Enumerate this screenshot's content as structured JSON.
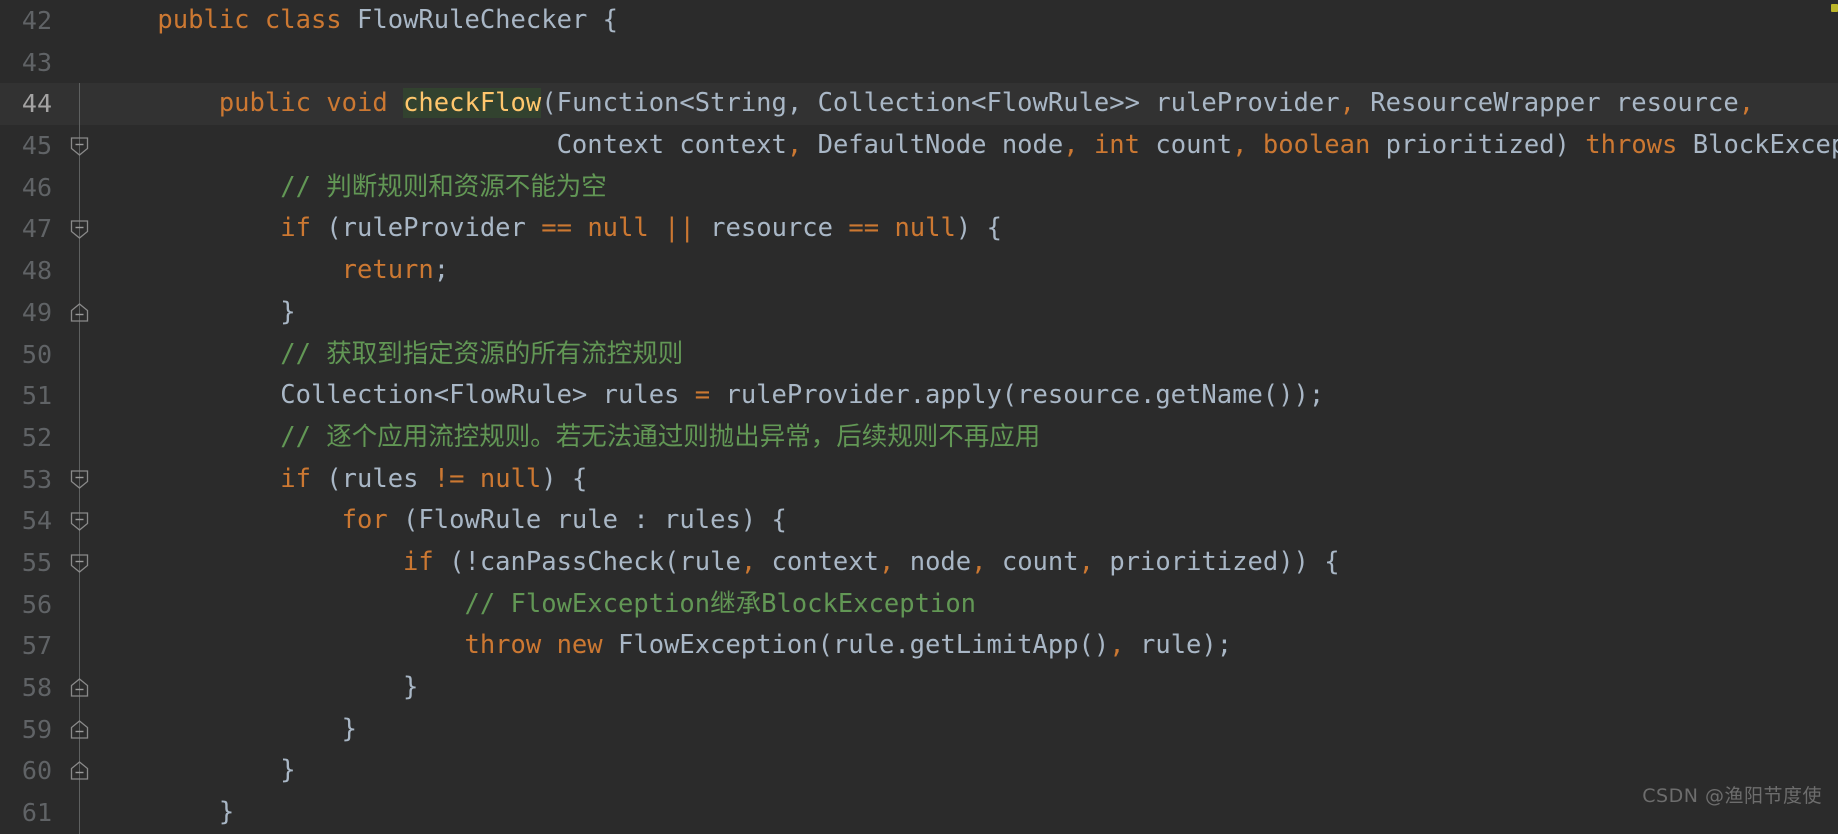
{
  "app": {
    "type": "code-editor",
    "theme": "darcula",
    "language": "java",
    "background": "#2b2b2b",
    "current_line_background": "#323232",
    "gutter_text_color": "#606366",
    "default_text_color": "#a9b7c6",
    "keyword_color": "#cc7832",
    "comment_color": "#629755",
    "method_color": "#ffc66d",
    "method_highlight_background": "#32422f",
    "number_color": "#6897bb"
  },
  "watermark": {
    "text": "CSDN @渔阳节度使"
  },
  "editor": {
    "first_line_number": 42,
    "current_line_number": 44,
    "lines": [
      {
        "number": "42",
        "fold": "none",
        "fold_line": false,
        "current": false,
        "tokens": [
          {
            "t": "    ",
            "c": "plain"
          },
          {
            "t": "public class ",
            "c": "kw"
          },
          {
            "t": "FlowRuleChecker ",
            "c": "plain"
          },
          {
            "t": "{",
            "c": "punc"
          }
        ],
        "plain": "public class FlowRuleChecker {"
      },
      {
        "number": "43",
        "fold": "none",
        "fold_line": false,
        "current": false,
        "tokens": [],
        "plain": ""
      },
      {
        "number": "44",
        "fold": "none",
        "fold_line": true,
        "current": true,
        "tokens": [
          {
            "t": "        ",
            "c": "plain"
          },
          {
            "t": "public void ",
            "c": "kw"
          },
          {
            "t": "checkFlow",
            "c": "method-hl"
          },
          {
            "t": "(Function<String, Collection<FlowRule>> ruleProvider",
            "c": "plain"
          },
          {
            "t": ",",
            "c": "kw"
          },
          {
            "t": " ResourceWrapper resource",
            "c": "plain"
          },
          {
            "t": ",",
            "c": "kw"
          }
        ],
        "plain": "public void checkFlow(Function<String, Collection<FlowRule>> ruleProvider, ResourceWrapper resource,"
      },
      {
        "number": "45",
        "fold": "start",
        "fold_line": true,
        "current": false,
        "tokens": [
          {
            "t": "                              ",
            "c": "plain"
          },
          {
            "t": "Context context",
            "c": "plain"
          },
          {
            "t": ",",
            "c": "kw"
          },
          {
            "t": " DefaultNode node",
            "c": "plain"
          },
          {
            "t": ",",
            "c": "kw"
          },
          {
            "t": " ",
            "c": "plain"
          },
          {
            "t": "int",
            "c": "kw"
          },
          {
            "t": " count",
            "c": "plain"
          },
          {
            "t": ",",
            "c": "kw"
          },
          {
            "t": " ",
            "c": "plain"
          },
          {
            "t": "boolean",
            "c": "kw"
          },
          {
            "t": " prioritized) ",
            "c": "plain"
          },
          {
            "t": "throws",
            "c": "kw"
          },
          {
            "t": " BlockException",
            "c": "plain"
          }
        ],
        "plain": "Context context, DefaultNode node, int count, boolean prioritized) throws BlockException"
      },
      {
        "number": "46",
        "fold": "none",
        "fold_line": true,
        "current": false,
        "tokens": [
          {
            "t": "            ",
            "c": "plain"
          },
          {
            "t": "// 判断规则和资源不能为空",
            "c": "comment"
          }
        ],
        "plain": "// 判断规则和资源不能为空"
      },
      {
        "number": "47",
        "fold": "start",
        "fold_line": true,
        "current": false,
        "tokens": [
          {
            "t": "            ",
            "c": "plain"
          },
          {
            "t": "if",
            "c": "kw"
          },
          {
            "t": " (ruleProvider ",
            "c": "plain"
          },
          {
            "t": "==",
            "c": "kw"
          },
          {
            "t": " ",
            "c": "plain"
          },
          {
            "t": "null",
            "c": "kw"
          },
          {
            "t": " ",
            "c": "plain"
          },
          {
            "t": "||",
            "c": "kw"
          },
          {
            "t": " resource ",
            "c": "plain"
          },
          {
            "t": "==",
            "c": "kw"
          },
          {
            "t": " ",
            "c": "plain"
          },
          {
            "t": "null",
            "c": "kw"
          },
          {
            "t": ") {",
            "c": "plain"
          }
        ],
        "plain": "if (ruleProvider == null || resource == null) {"
      },
      {
        "number": "48",
        "fold": "none",
        "fold_line": true,
        "current": false,
        "tokens": [
          {
            "t": "                ",
            "c": "plain"
          },
          {
            "t": "return",
            "c": "kw"
          },
          {
            "t": ";",
            "c": "plain"
          }
        ],
        "plain": "return;"
      },
      {
        "number": "49",
        "fold": "end",
        "fold_line": true,
        "current": false,
        "tokens": [
          {
            "t": "            ",
            "c": "plain"
          },
          {
            "t": "}",
            "c": "plain"
          }
        ],
        "plain": "}"
      },
      {
        "number": "50",
        "fold": "none",
        "fold_line": true,
        "current": false,
        "tokens": [
          {
            "t": "            ",
            "c": "plain"
          },
          {
            "t": "// 获取到指定资源的所有流控规则",
            "c": "comment"
          }
        ],
        "plain": "// 获取到指定资源的所有流控规则"
      },
      {
        "number": "51",
        "fold": "none",
        "fold_line": true,
        "current": false,
        "tokens": [
          {
            "t": "            ",
            "c": "plain"
          },
          {
            "t": "Collection<FlowRule> rules ",
            "c": "plain"
          },
          {
            "t": "=",
            "c": "kw"
          },
          {
            "t": " ruleProvider.apply(resource.getName());",
            "c": "plain"
          }
        ],
        "plain": "Collection<FlowRule> rules = ruleProvider.apply(resource.getName());"
      },
      {
        "number": "52",
        "fold": "none",
        "fold_line": true,
        "current": false,
        "tokens": [
          {
            "t": "            ",
            "c": "plain"
          },
          {
            "t": "// 逐个应用流控规则。若无法通过则抛出异常，后续规则不再应用",
            "c": "comment"
          }
        ],
        "plain": "// 逐个应用流控规则。若无法通过则抛出异常，后续规则不再应用"
      },
      {
        "number": "53",
        "fold": "start",
        "fold_line": true,
        "current": false,
        "tokens": [
          {
            "t": "            ",
            "c": "plain"
          },
          {
            "t": "if",
            "c": "kw"
          },
          {
            "t": " (rules ",
            "c": "plain"
          },
          {
            "t": "!=",
            "c": "kw"
          },
          {
            "t": " ",
            "c": "plain"
          },
          {
            "t": "null",
            "c": "kw"
          },
          {
            "t": ") {",
            "c": "plain"
          }
        ],
        "plain": "if (rules != null) {"
      },
      {
        "number": "54",
        "fold": "start",
        "fold_line": true,
        "current": false,
        "tokens": [
          {
            "t": "                ",
            "c": "plain"
          },
          {
            "t": "for",
            "c": "kw"
          },
          {
            "t": " (FlowRule rule : rules) {",
            "c": "plain"
          }
        ],
        "plain": "for (FlowRule rule : rules) {"
      },
      {
        "number": "55",
        "fold": "start",
        "fold_line": true,
        "current": false,
        "tokens": [
          {
            "t": "                    ",
            "c": "plain"
          },
          {
            "t": "if",
            "c": "kw"
          },
          {
            "t": " (!canPassCheck(rule",
            "c": "plain"
          },
          {
            "t": ",",
            "c": "kw"
          },
          {
            "t": " context",
            "c": "plain"
          },
          {
            "t": ",",
            "c": "kw"
          },
          {
            "t": " node",
            "c": "plain"
          },
          {
            "t": ",",
            "c": "kw"
          },
          {
            "t": " count",
            "c": "plain"
          },
          {
            "t": ",",
            "c": "kw"
          },
          {
            "t": " prioritized)) {",
            "c": "plain"
          }
        ],
        "plain": "if (!canPassCheck(rule, context, node, count, prioritized)) {"
      },
      {
        "number": "56",
        "fold": "none",
        "fold_line": true,
        "current": false,
        "tokens": [
          {
            "t": "                        ",
            "c": "plain"
          },
          {
            "t": "// FlowException继承BlockException",
            "c": "comment"
          }
        ],
        "plain": "// FlowException继承BlockException"
      },
      {
        "number": "57",
        "fold": "none",
        "fold_line": true,
        "current": false,
        "tokens": [
          {
            "t": "                        ",
            "c": "plain"
          },
          {
            "t": "throw new",
            "c": "kw"
          },
          {
            "t": " FlowException(rule.getLimitApp()",
            "c": "plain"
          },
          {
            "t": ",",
            "c": "kw"
          },
          {
            "t": " rule);",
            "c": "plain"
          }
        ],
        "plain": "throw new FlowException(rule.getLimitApp(), rule);"
      },
      {
        "number": "58",
        "fold": "end",
        "fold_line": true,
        "current": false,
        "tokens": [
          {
            "t": "                    ",
            "c": "plain"
          },
          {
            "t": "}",
            "c": "plain"
          }
        ],
        "plain": "}"
      },
      {
        "number": "59",
        "fold": "end",
        "fold_line": true,
        "current": false,
        "tokens": [
          {
            "t": "                ",
            "c": "plain"
          },
          {
            "t": "}",
            "c": "plain"
          }
        ],
        "plain": "}"
      },
      {
        "number": "60",
        "fold": "end",
        "fold_line": true,
        "current": false,
        "tokens": [
          {
            "t": "            ",
            "c": "plain"
          },
          {
            "t": "}",
            "c": "plain"
          }
        ],
        "plain": "}"
      },
      {
        "number": "61",
        "fold": "none",
        "fold_line": true,
        "current": false,
        "tokens": [
          {
            "t": "        ",
            "c": "plain"
          },
          {
            "t": "}",
            "c": "plain"
          }
        ],
        "plain": "}"
      }
    ]
  }
}
